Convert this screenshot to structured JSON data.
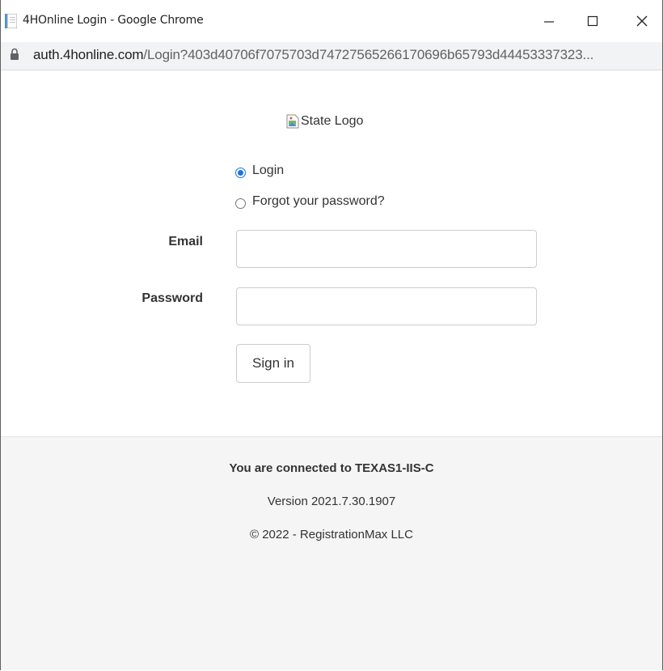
{
  "window": {
    "title": "4HOnline Login - Google Chrome",
    "url_host": "auth.4honline.com",
    "url_path": "/Login?403d40706f7075703d7472756526617069​6b65793d44453337323..."
  },
  "page": {
    "logo_alt": "State Logo",
    "radios": [
      {
        "label": "Login",
        "checked": true
      },
      {
        "label": "Forgot your password?",
        "checked": false
      }
    ],
    "email_label": "Email",
    "email_value": "",
    "password_label": "Password",
    "password_value": "",
    "signin_label": "Sign in"
  },
  "footer": {
    "connected": "You are connected to TEXAS1-IIS-C",
    "version": "Version 2021.7.30.1907",
    "copyright": "© 2022 - RegistrationMax LLC"
  },
  "colors": {
    "accent": "#1a73e8",
    "footer_bg": "#f5f5f5",
    "address_bg": "#f1f3f4"
  },
  "icons": [
    "page-favicon-icon",
    "minimize-icon",
    "maximize-icon",
    "close-icon",
    "lock-icon",
    "broken-image-icon"
  ]
}
